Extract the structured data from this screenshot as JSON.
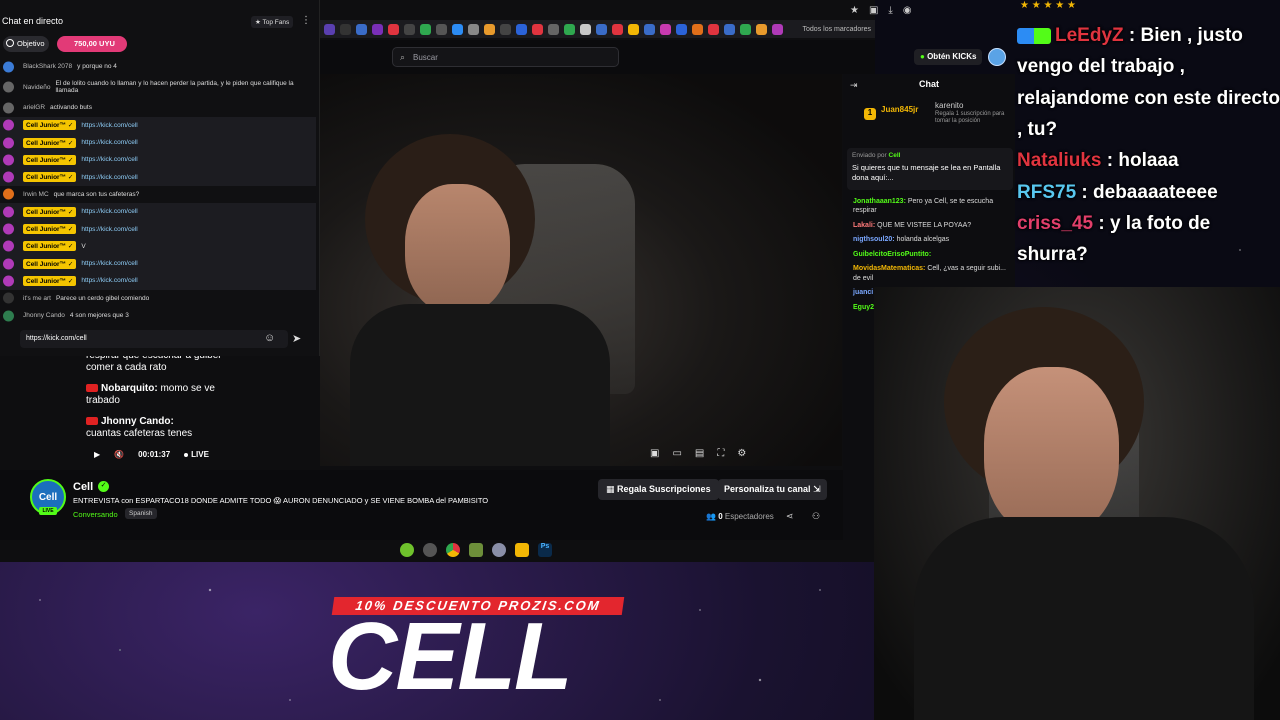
{
  "browser": {
    "bookmarks_label": "Todos los marcadores",
    "search_placeholder": "Buscar",
    "get_kicks": "Obtén KICKs"
  },
  "left_chat": {
    "title": "Chat en directo",
    "top_fans": "Top Fans",
    "goal_label": "Objetivo",
    "goal_amount": "750,00 UYU",
    "input_value": "https://kick.com/cell",
    "messages": [
      {
        "user": "BlackShark 2078",
        "text": "y porque no 4",
        "badge": "",
        "link": "",
        "color": "#3b7bd6",
        "hl": false,
        "two": false
      },
      {
        "user": "Navideño",
        "text": "El de lolito cuando lo llaman y lo hacen perder la partida, y le piden que califique la llamada",
        "badge": "",
        "link": "",
        "color": "#666",
        "hl": false,
        "two": true
      },
      {
        "user": "arielGR",
        "text": "activando buts",
        "badge": "",
        "link": "",
        "color": "#666",
        "hl": false,
        "two": false
      },
      {
        "user": "",
        "text": "",
        "badge": "Cell Junior™ ✓",
        "link": "https://kick.com/cell",
        "color": "#b03ab8",
        "hl": true,
        "two": false
      },
      {
        "user": "",
        "text": "",
        "badge": "Cell Junior™ ✓",
        "link": "https://kick.com/cell",
        "color": "#b03ab8",
        "hl": true,
        "two": false
      },
      {
        "user": "",
        "text": "",
        "badge": "Cell Junior™ ✓",
        "link": "https://kick.com/cell",
        "color": "#b03ab8",
        "hl": true,
        "two": false
      },
      {
        "user": "",
        "text": "",
        "badge": "Cell Junior™ ✓",
        "link": "https://kick.com/cell",
        "color": "#b03ab8",
        "hl": true,
        "two": false
      },
      {
        "user": "Irwin MC",
        "text": "que marca son tus cafeteras?",
        "badge": "",
        "link": "",
        "color": "#e06f1a",
        "hl": false,
        "two": false
      },
      {
        "user": "",
        "text": "",
        "badge": "Cell Junior™ ✓",
        "link": "https://kick.com/cell",
        "color": "#b03ab8",
        "hl": true,
        "two": false
      },
      {
        "user": "",
        "text": "",
        "badge": "Cell Junior™ ✓",
        "link": "https://kick.com/cell",
        "color": "#b03ab8",
        "hl": true,
        "two": false
      },
      {
        "user": "",
        "text": "V",
        "badge": "Cell Junior™ ✓",
        "link": "",
        "color": "#b03ab8",
        "hl": true,
        "two": false
      },
      {
        "user": "",
        "text": "",
        "badge": "Cell Junior™ ✓",
        "link": "https://kick.com/cell",
        "color": "#b03ab8",
        "hl": true,
        "two": false
      },
      {
        "user": "",
        "text": "",
        "badge": "Cell Junior™ ✓",
        "link": "https://kick.com/cell",
        "color": "#b03ab8",
        "hl": true,
        "two": false
      },
      {
        "user": "it's me art",
        "text": "Parece un cerdo gibel comiendo",
        "badge": "",
        "link": "",
        "color": "#333",
        "hl": false,
        "two": false
      },
      {
        "user": "Jhonny Cando",
        "text": "4 son mejores que 3",
        "badge": "",
        "link": "",
        "color": "#2e7d4f",
        "hl": false,
        "two": false
      }
    ]
  },
  "video_chat": {
    "line1": "respirar que escuchar a guibel comer a cada rato",
    "m2_user": "Nobarquito:",
    "m2_text": "momo se ve trabado",
    "m3_user": "Jhonny Cando:",
    "m3_text": "cuantas cafeteras tenes",
    "time": "00:01:37",
    "live": "LIVE"
  },
  "kick_chat": {
    "title": "Chat",
    "top_user": "Juan845jr",
    "top_rank": "1",
    "top_count": "5",
    "gift_user": "karenito",
    "gift_text": "Regala 1 suscripción para tomar la posición",
    "pinned_by": "Enviado por",
    "pinned_user": "Cell",
    "pinned_text": "Si quieres que tu mensaje se lea en Pantalla dona aquí:...",
    "messages": [
      {
        "user": "Jonathaaan123:",
        "text": "Pero ya Cell, se te escucha respirar",
        "color": "#53fc18"
      },
      {
        "user": "Lakali:",
        "text": "QUE ME VISTEE LA POYAA?",
        "color": "#ff7a7a"
      },
      {
        "user": "nigthsoul20:",
        "text": "holanda alcelgas",
        "color": "#7aa7ff"
      },
      {
        "user": "GuibelcitoErisoPuntito:",
        "text": "",
        "color": "#53fc18"
      },
      {
        "user": "MovidasMatematicas:",
        "text": "Cell, ¿vas a seguir subi... de evil",
        "color": "#f2b705"
      },
      {
        "user": "juanci",
        "text": "estas?",
        "color": "#7aa7ff"
      },
      {
        "user": "Eguy2",
        "text": "",
        "color": "#53fc18"
      }
    ]
  },
  "stream": {
    "streamer": "Cell",
    "avatar_text": "Cell",
    "live_badge": "LIVE",
    "title": "ENTREVISTA con ESPARTACO18 DONDE ADMITE TODO 😱 AURON DENUNCIADO y SE VIENE BOMBA del PAMBISITO",
    "category": "Conversando",
    "language": "Spanish",
    "gift_subs": "Regala Suscripciones",
    "customize": "Personaliza tu canal",
    "viewers_count": "0",
    "viewers_label": "Espectadores"
  },
  "overlay_chat": {
    "u1": "LeEdyZ",
    "t1": ": Bien , justo vengo del trabajo , relajandome con este directo , tu?",
    "u2": "Nataliuks",
    "t2": ": holaaa",
    "u3": "RFS75",
    "t3": ": debaaaateeee",
    "u4": "criss_45",
    "t4": ": y la foto de shurra?"
  },
  "promo": {
    "strip": "10% DESCUENTO PROZIS.COM",
    "big": "CELL"
  }
}
